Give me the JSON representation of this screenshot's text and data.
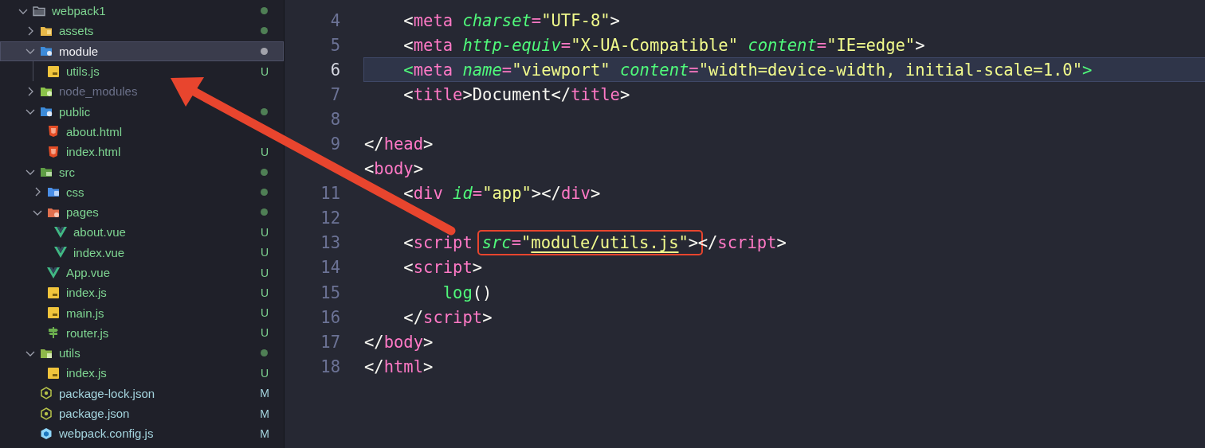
{
  "explorer": {
    "items": [
      {
        "name": "webpack1",
        "kind": "folder",
        "expanded": true,
        "selected": false,
        "ignored": false,
        "modified": false,
        "dot": true,
        "children": [
          {
            "name": "assets",
            "kind": "folder",
            "expanded": false,
            "selected": false,
            "ignored": false,
            "modified": false,
            "dot": true
          },
          {
            "name": "module",
            "kind": "folder",
            "expanded": true,
            "selected": true,
            "ignored": false,
            "modified": false,
            "dot": true,
            "children": [
              {
                "name": "utils.js",
                "kind": "script",
                "selected": false,
                "ignored": false,
                "modified": false,
                "badge": "U"
              }
            ]
          },
          {
            "name": "node_modules",
            "kind": "folder",
            "expanded": false,
            "selected": false,
            "ignored": true,
            "modified": false,
            "dot": false
          },
          {
            "name": "public",
            "kind": "folder",
            "expanded": true,
            "selected": false,
            "ignored": false,
            "modified": false,
            "dot": true,
            "children": [
              {
                "name": "about.html",
                "kind": "markup",
                "selected": false,
                "ignored": false,
                "modified": false
              },
              {
                "name": "index.html",
                "kind": "markup",
                "selected": false,
                "ignored": false,
                "modified": false,
                "badge": "U"
              }
            ]
          },
          {
            "name": "src",
            "kind": "folder",
            "expanded": true,
            "selected": false,
            "ignored": false,
            "modified": false,
            "dot": true,
            "children": [
              {
                "name": "css",
                "kind": "folder",
                "expanded": false,
                "selected": false,
                "ignored": false,
                "modified": false,
                "dot": true
              },
              {
                "name": "pages",
                "kind": "folder",
                "expanded": true,
                "selected": false,
                "ignored": false,
                "modified": false,
                "dot": true,
                "children": [
                  {
                    "name": "about.vue",
                    "kind": "vue",
                    "selected": false,
                    "ignored": false,
                    "modified": false,
                    "badge": "U"
                  },
                  {
                    "name": "index.vue",
                    "kind": "vue",
                    "selected": false,
                    "ignored": false,
                    "modified": false,
                    "badge": "U"
                  }
                ]
              },
              {
                "name": "App.vue",
                "kind": "vue",
                "selected": false,
                "ignored": false,
                "modified": false,
                "badge": "U"
              },
              {
                "name": "index.js",
                "kind": "script",
                "selected": false,
                "ignored": false,
                "modified": false,
                "badge": "U"
              },
              {
                "name": "main.js",
                "kind": "script",
                "selected": false,
                "ignored": false,
                "modified": false,
                "badge": "U"
              },
              {
                "name": "router.js",
                "kind": "router",
                "selected": false,
                "ignored": false,
                "modified": false,
                "badge": "U"
              }
            ]
          },
          {
            "name": "utils",
            "kind": "folder",
            "expanded": true,
            "selected": false,
            "ignored": false,
            "modified": false,
            "dot": true,
            "children": [
              {
                "name": "index.js",
                "kind": "script",
                "selected": false,
                "ignored": false,
                "modified": false,
                "badge": "U"
              }
            ]
          },
          {
            "name": "package-lock.json",
            "kind": "manifest",
            "selected": false,
            "ignored": false,
            "modified": true,
            "badge": "M"
          },
          {
            "name": "package.json",
            "kind": "manifest",
            "selected": false,
            "ignored": false,
            "modified": true,
            "badge": "M"
          },
          {
            "name": "webpack.config.js",
            "kind": "config",
            "selected": false,
            "ignored": false,
            "modified": true,
            "badge": "M"
          }
        ]
      }
    ]
  },
  "editor": {
    "lines": [
      {
        "number": "4",
        "current": false,
        "tokens": [
          {
            "kind": "punct",
            "text": "    <"
          },
          {
            "kind": "tag",
            "text": "meta "
          },
          {
            "kind": "attr",
            "text": "charset"
          },
          {
            "kind": "op",
            "text": "="
          },
          {
            "kind": "string",
            "text": "\"UTF-8\""
          },
          {
            "kind": "punct",
            "text": ">"
          }
        ]
      },
      {
        "number": "5",
        "current": false,
        "tokens": [
          {
            "kind": "punct",
            "text": "    <"
          },
          {
            "kind": "tag",
            "text": "meta "
          },
          {
            "kind": "attr",
            "text": "http-equiv"
          },
          {
            "kind": "op",
            "text": "="
          },
          {
            "kind": "string",
            "text": "\"X-UA-Compatible\" "
          },
          {
            "kind": "attr",
            "text": "content"
          },
          {
            "kind": "op",
            "text": "="
          },
          {
            "kind": "string",
            "text": "\"IE=edge\""
          },
          {
            "kind": "punct",
            "text": ">"
          }
        ]
      },
      {
        "number": "6",
        "current": true,
        "tokens": [
          {
            "kind": "match",
            "text": "    <"
          },
          {
            "kind": "tag",
            "text": "meta "
          },
          {
            "kind": "attr",
            "text": "name"
          },
          {
            "kind": "op",
            "text": "="
          },
          {
            "kind": "string",
            "text": "\"viewport\" "
          },
          {
            "kind": "attr",
            "text": "content"
          },
          {
            "kind": "op",
            "text": "="
          },
          {
            "kind": "string",
            "text": "\"width=device-width, initial-scale=1.0\""
          },
          {
            "kind": "match",
            "text": ">"
          }
        ]
      },
      {
        "number": "7",
        "current": false,
        "tokens": [
          {
            "kind": "punct",
            "text": "    <"
          },
          {
            "kind": "tag",
            "text": "title"
          },
          {
            "kind": "punct",
            "text": ">Document</"
          },
          {
            "kind": "tag",
            "text": "title"
          },
          {
            "kind": "punct",
            "text": ">"
          }
        ]
      },
      {
        "number": "8",
        "current": false
      },
      {
        "number": "9",
        "current": false,
        "tokens": [
          {
            "kind": "punct",
            "text": "</"
          },
          {
            "kind": "tag",
            "text": "head"
          },
          {
            "kind": "punct",
            "text": ">"
          }
        ]
      },
      {
        "current": false,
        "tokens": [
          {
            "kind": "punct",
            "text": "<"
          },
          {
            "kind": "tag",
            "text": "body"
          },
          {
            "kind": "punct",
            "text": ">"
          }
        ]
      },
      {
        "number": "11",
        "current": false,
        "tokens": [
          {
            "kind": "punct",
            "text": "    <"
          },
          {
            "kind": "tag",
            "text": "div "
          },
          {
            "kind": "attr",
            "text": "id"
          },
          {
            "kind": "op",
            "text": "="
          },
          {
            "kind": "string",
            "text": "\"app\""
          },
          {
            "kind": "punct",
            "text": "></"
          },
          {
            "kind": "tag",
            "text": "div"
          },
          {
            "kind": "punct",
            "text": ">"
          }
        ]
      },
      {
        "number": "12",
        "current": false
      },
      {
        "number": "13",
        "current": false,
        "tokens": [
          {
            "kind": "punct",
            "text": "    <"
          },
          {
            "kind": "tag",
            "text": "script "
          },
          {
            "kind": "attr",
            "text": "src",
            "boxed": true
          },
          {
            "kind": "op",
            "text": "=",
            "boxed": true
          },
          {
            "kind": "string",
            "text": "\"",
            "boxed": true
          },
          {
            "kind": "string",
            "text": "module/utils.js",
            "boxed": true,
            "underlined": true
          },
          {
            "kind": "string",
            "text": "\"",
            "boxed": true
          },
          {
            "kind": "punct",
            "text": ">",
            "boxed": true
          },
          {
            "kind": "punct",
            "text": "</"
          },
          {
            "kind": "tag",
            "text": "script"
          },
          {
            "kind": "punct",
            "text": ">"
          }
        ]
      },
      {
        "number": "14",
        "current": false,
        "tokens": [
          {
            "kind": "punct",
            "text": "    <"
          },
          {
            "kind": "tag",
            "text": "script"
          },
          {
            "kind": "punct",
            "text": ">"
          }
        ]
      },
      {
        "number": "15",
        "current": false,
        "tokens": [
          {
            "kind": "func",
            "text": "        log"
          },
          {
            "kind": "punct",
            "text": "()"
          }
        ]
      },
      {
        "number": "16",
        "current": false,
        "tokens": [
          {
            "kind": "punct",
            "text": "    </"
          },
          {
            "kind": "tag",
            "text": "script"
          },
          {
            "kind": "punct",
            "text": ">"
          }
        ]
      },
      {
        "number": "17",
        "current": false,
        "tokens": [
          {
            "kind": "punct",
            "text": "</"
          },
          {
            "kind": "tag",
            "text": "body"
          },
          {
            "kind": "punct",
            "text": ">"
          }
        ]
      },
      {
        "number": "18",
        "current": false,
        "tokens": [
          {
            "kind": "punct",
            "text": "</"
          },
          {
            "kind": "tag",
            "text": "html"
          },
          {
            "kind": "punct",
            "text": ">"
          }
        ]
      }
    ]
  },
  "annotations": [
    {
      "kind": "arrow"
    }
  ]
}
